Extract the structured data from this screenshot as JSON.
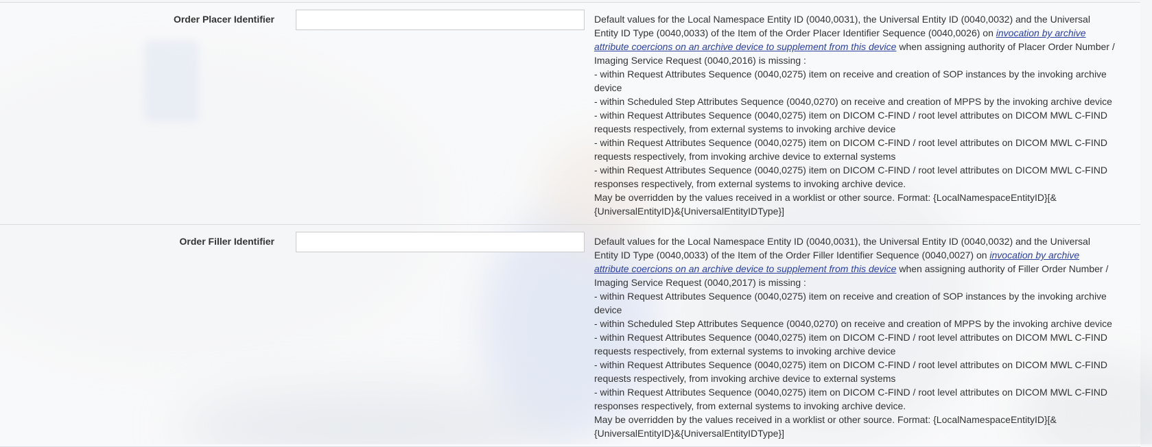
{
  "fields": [
    {
      "label": "Order Placer Identifier",
      "value": "",
      "desc_intro_1": "Default values for the Local Namespace Entity ID (0040,0031), the Universal Entity ID (0040,0032) and the Universal Entity ID Type (0040,0033) of the Item of the Order Placer Identifier Sequence (0040,0026) on ",
      "desc_link": "invocation by archive attribute coercions on an archive device to supplement from this device",
      "desc_intro_2": " when assigning authority of Placer Order Number / Imaging Service Request (0040,2016) is missing :",
      "desc_items": [
        "- within Request Attributes Sequence (0040,0275) item on receive and creation of SOP instances by the invoking archive device",
        "- within Scheduled Step Attributes Sequence (0040,0270) on receive and creation of MPPS by the invoking archive device",
        "- within Request Attributes Sequence (0040,0275) item on DICOM C-FIND / root level attributes on DICOM MWL C-FIND requests respectively, from external systems to invoking archive device",
        "- within Request Attributes Sequence (0040,0275) item on DICOM C-FIND / root level attributes on DICOM MWL C-FIND requests respectively, from invoking archive device to external systems",
        "- within Request Attributes Sequence (0040,0275) item on DICOM C-FIND / root level attributes on DICOM MWL C-FIND responses respectively, from external systems to invoking archive device."
      ],
      "desc_outro": "May be overridden by the values received in a worklist or other source. Format: {LocalNamespaceEntityID}[&{UniversalEntityID}&{UniversalEntityIDType}]"
    },
    {
      "label": "Order Filler Identifier",
      "value": "",
      "desc_intro_1": "Default values for the Local Namespace Entity ID (0040,0031), the Universal Entity ID (0040,0032) and the Universal Entity ID Type (0040,0033) of the Item of the Order Filler Identifier Sequence (0040,0027) on ",
      "desc_link": "invocation by archive attribute coercions on an archive device to supplement from this device",
      "desc_intro_2": " when assigning authority of Filler Order Number / Imaging Service Request (0040,2017) is missing :",
      "desc_items": [
        "- within Request Attributes Sequence (0040,0275) item on receive and creation of SOP instances by the invoking archive device",
        "- within Scheduled Step Attributes Sequence (0040,0270) on receive and creation of MPPS by the invoking archive device",
        "- within Request Attributes Sequence (0040,0275) item on DICOM C-FIND / root level attributes on DICOM MWL C-FIND requests respectively, from external systems to invoking archive device",
        "- within Request Attributes Sequence (0040,0275) item on DICOM C-FIND / root level attributes on DICOM MWL C-FIND requests respectively, from invoking archive device to external systems",
        "- within Request Attributes Sequence (0040,0275) item on DICOM C-FIND / root level attributes on DICOM MWL C-FIND responses respectively, from external systems to invoking archive device."
      ],
      "desc_outro": "May be overridden by the values received in a worklist or other source. Format: {LocalNamespaceEntityID}[&{UniversalEntityID}&{UniversalEntityIDType}]"
    }
  ],
  "colors": {
    "link": "#2a3f9f",
    "text": "#333333",
    "divider": "#dcdcdc"
  }
}
